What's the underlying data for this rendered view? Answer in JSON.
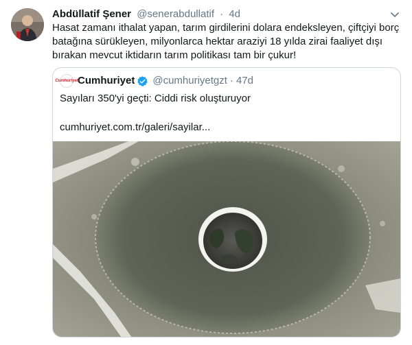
{
  "tweet": {
    "author_name": "Abdüllatif Şener",
    "handle": "@senerabdullatif",
    "separator": "·",
    "time": "4d",
    "text": "Hasat zamanı ithalat yapan, tarım girdilerini dolara endeksleyen, çiftçiyi borç batağına sürükleyen, milyonlarca hektar araziyi 18 yılda zirai faaliyet dışı bırakan mevcut iktidarın tarım politikası tam bir çukur!"
  },
  "quoted": {
    "logo_text": "Cumhuriyet",
    "author_name": "Cumhuriyet",
    "handle": "@cumhuriyetgzt",
    "separator": "·",
    "time": "47d",
    "text": "Sayıları 350'yi geçti: Ciddi risk oluşturuyor",
    "link": "cumhuriyet.com.tr/galeri/sayilar..."
  },
  "icons": {
    "verified": "verified-badge-icon",
    "menu": "chevron-down-icon"
  },
  "colors": {
    "text": "#14171a",
    "secondary": "#657786",
    "verified": "#1da1f2",
    "border": "#ccd6dd"
  }
}
